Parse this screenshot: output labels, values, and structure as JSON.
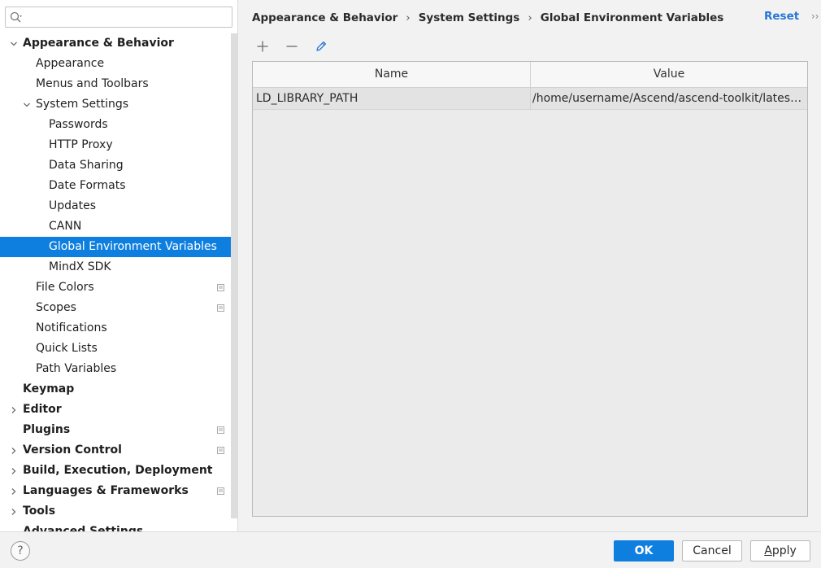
{
  "search": {
    "placeholder": "",
    "value": ""
  },
  "sidebar": {
    "items": [
      {
        "label": "Appearance & Behavior",
        "level": 0,
        "bold": true,
        "expanded": true,
        "arrow": "down",
        "badge": false,
        "selected": false
      },
      {
        "label": "Appearance",
        "level": 1,
        "bold": false,
        "arrow": null,
        "badge": false,
        "selected": false
      },
      {
        "label": "Menus and Toolbars",
        "level": 1,
        "bold": false,
        "arrow": null,
        "badge": false,
        "selected": false
      },
      {
        "label": "System Settings",
        "level": 1,
        "bold": false,
        "arrow": "down",
        "badge": false,
        "selected": false
      },
      {
        "label": "Passwords",
        "level": 2,
        "bold": false,
        "arrow": null,
        "badge": false,
        "selected": false
      },
      {
        "label": "HTTP Proxy",
        "level": 2,
        "bold": false,
        "arrow": null,
        "badge": false,
        "selected": false
      },
      {
        "label": "Data Sharing",
        "level": 2,
        "bold": false,
        "arrow": null,
        "badge": false,
        "selected": false
      },
      {
        "label": "Date Formats",
        "level": 2,
        "bold": false,
        "arrow": null,
        "badge": false,
        "selected": false
      },
      {
        "label": "Updates",
        "level": 2,
        "bold": false,
        "arrow": null,
        "badge": false,
        "selected": false
      },
      {
        "label": "CANN",
        "level": 2,
        "bold": false,
        "arrow": null,
        "badge": false,
        "selected": false
      },
      {
        "label": "Global Environment Variables",
        "level": 2,
        "bold": false,
        "arrow": null,
        "badge": false,
        "selected": true
      },
      {
        "label": "MindX SDK",
        "level": 2,
        "bold": false,
        "arrow": null,
        "badge": false,
        "selected": false
      },
      {
        "label": "File Colors",
        "level": 1,
        "bold": false,
        "arrow": null,
        "badge": true,
        "selected": false
      },
      {
        "label": "Scopes",
        "level": 1,
        "bold": false,
        "arrow": null,
        "badge": true,
        "selected": false
      },
      {
        "label": "Notifications",
        "level": 1,
        "bold": false,
        "arrow": null,
        "badge": false,
        "selected": false
      },
      {
        "label": "Quick Lists",
        "level": 1,
        "bold": false,
        "arrow": null,
        "badge": false,
        "selected": false
      },
      {
        "label": "Path Variables",
        "level": 1,
        "bold": false,
        "arrow": null,
        "badge": false,
        "selected": false
      },
      {
        "label": "Keymap",
        "level": 0,
        "bold": true,
        "arrow": null,
        "badge": false,
        "selected": false
      },
      {
        "label": "Editor",
        "level": 0,
        "bold": true,
        "arrow": "right",
        "badge": false,
        "selected": false
      },
      {
        "label": "Plugins",
        "level": 0,
        "bold": true,
        "arrow": null,
        "badge": true,
        "selected": false
      },
      {
        "label": "Version Control",
        "level": 0,
        "bold": true,
        "arrow": "right",
        "badge": true,
        "selected": false
      },
      {
        "label": "Build, Execution, Deployment",
        "level": 0,
        "bold": true,
        "arrow": "right",
        "badge": false,
        "selected": false
      },
      {
        "label": "Languages & Frameworks",
        "level": 0,
        "bold": true,
        "arrow": "right",
        "badge": true,
        "selected": false
      },
      {
        "label": "Tools",
        "level": 0,
        "bold": true,
        "arrow": "right",
        "badge": false,
        "selected": false
      },
      {
        "label": "Advanced Settings",
        "level": 0,
        "bold": true,
        "arrow": null,
        "badge": false,
        "selected": false
      }
    ]
  },
  "header": {
    "breadcrumb": [
      "Appearance & Behavior",
      "System Settings",
      "Global Environment Variables"
    ],
    "breadcrumb_separator": "›",
    "reset_label": "Reset",
    "more_label": "››"
  },
  "toolbar": {
    "add_icon": "plus-icon",
    "remove_icon": "minus-icon",
    "edit_icon": "pencil-icon"
  },
  "table": {
    "columns": [
      "Name",
      "Value"
    ],
    "rows": [
      {
        "name": "LD_LIBRARY_PATH",
        "value": "/home/username/Ascend/ascend-toolkit/latest/fw..."
      }
    ]
  },
  "footer": {
    "help_label": "?",
    "ok_label": "OK",
    "cancel_label": "Cancel",
    "apply_label_underlined": "A",
    "apply_label_rest": "pply"
  },
  "colors": {
    "accent": "#0f7fdf",
    "link": "#2675d6",
    "selection_text": "#ffffff"
  }
}
